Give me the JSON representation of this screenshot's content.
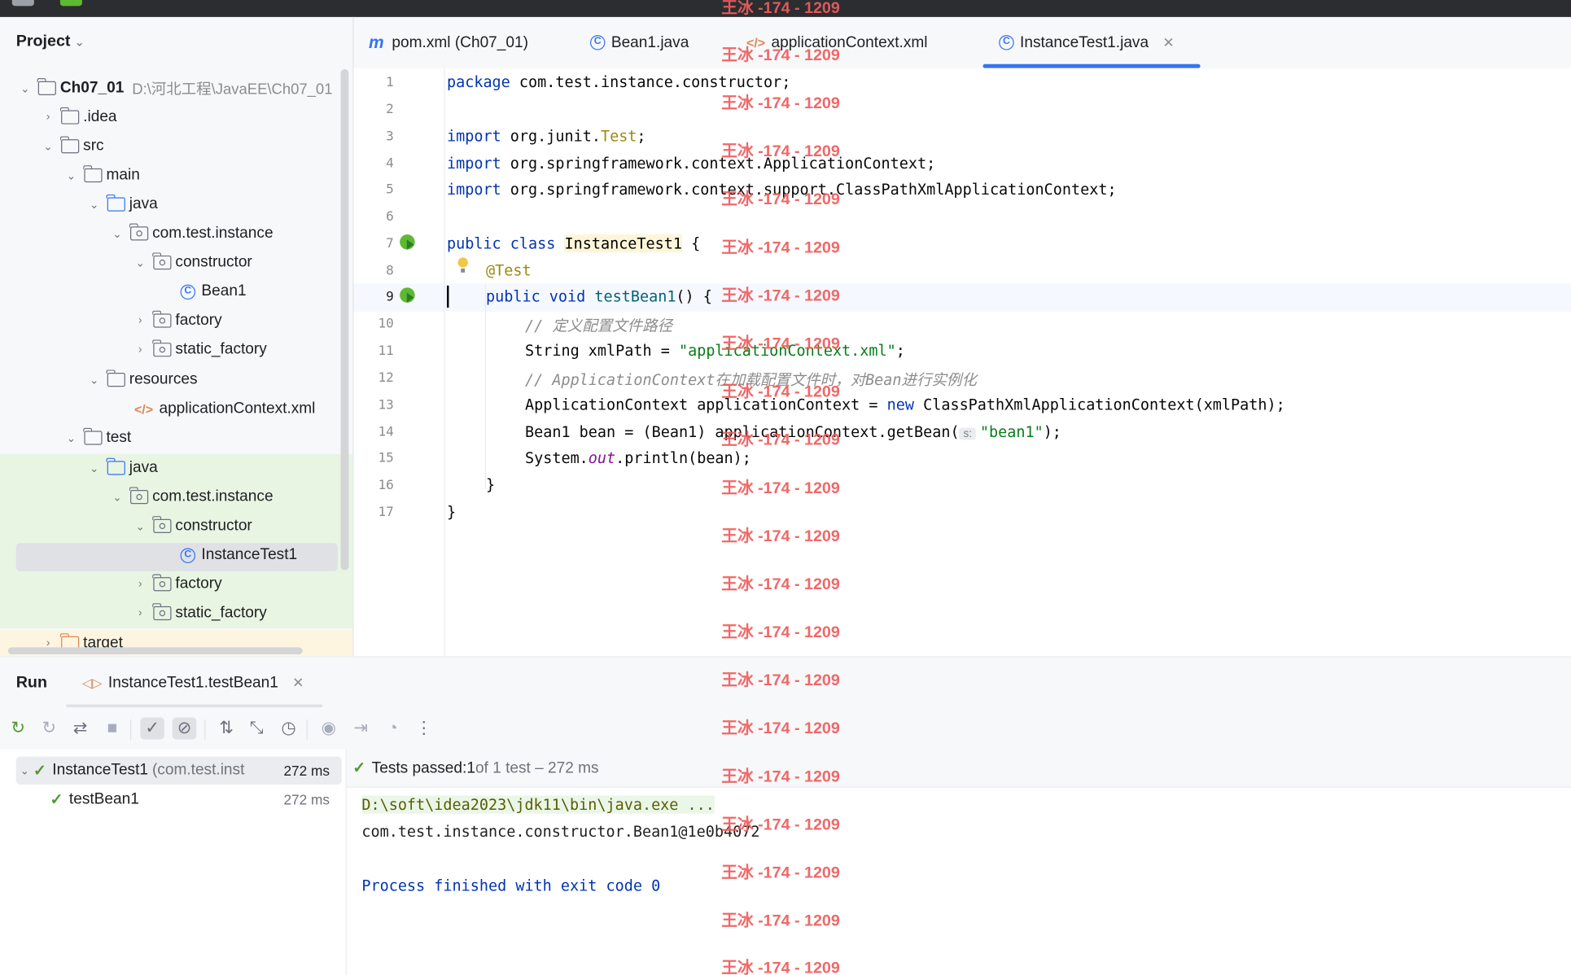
{
  "project": {
    "header": "Project",
    "root_name": "Ch07_01",
    "root_path": "D:\\河北工程\\JavaEE\\Ch07_01",
    "tree": [
      {
        "label": "Ch07_01"
      },
      {
        "label": ".idea"
      },
      {
        "label": "src"
      },
      {
        "label": "main"
      },
      {
        "label": "java"
      },
      {
        "label": "com.test.instance"
      },
      {
        "label": "constructor"
      },
      {
        "label": "Bean1"
      },
      {
        "label": "factory"
      },
      {
        "label": "static_factory"
      },
      {
        "label": "resources"
      },
      {
        "label": "applicationContext.xml"
      },
      {
        "label": "test"
      },
      {
        "label": "java"
      },
      {
        "label": "com.test.instance"
      },
      {
        "label": "constructor"
      },
      {
        "label": "InstanceTest1"
      },
      {
        "label": "factory"
      },
      {
        "label": "static_factory"
      },
      {
        "label": "target"
      }
    ]
  },
  "tabs": [
    {
      "label": "pom.xml (Ch07_01)"
    },
    {
      "label": "Bean1.java"
    },
    {
      "label": "applicationContext.xml"
    },
    {
      "label": "InstanceTest1.java"
    }
  ],
  "editor": {
    "line_numbers": [
      "1",
      "2",
      "3",
      "4",
      "5",
      "6",
      "7",
      "8",
      "9",
      "10",
      "11",
      "12",
      "13",
      "14",
      "15",
      "16",
      "17"
    ],
    "code": {
      "l1_kw": "package",
      "l1_rest": " com.test.instance.constructor;",
      "l3_kw": "import",
      "l3_a": " org.junit.",
      "l3_b": "Test",
      "l3_c": ";",
      "l4_kw": "import",
      "l4_rest": " org.springframework.context.ApplicationContext;",
      "l5_kw": "import",
      "l5_rest": " org.springframework.context.support.ClassPathXmlApplicationContext;",
      "l7_kw": "public class ",
      "l7_cls": "InstanceTest1",
      "l7_rest": " {",
      "l8_ann": "@Test",
      "l9_kw": "public void ",
      "l9_m": "testBean1",
      "l9_rest": "() {",
      "l10_cm": "// 定义配置文件路径",
      "l11_a": "String xmlPath = ",
      "l11_s": "\"applicationContext.xml\"",
      "l11_b": ";",
      "l12_cm": "// ApplicationContext在加载配置文件时，对Bean进行实例化",
      "l13_a": "ApplicationContext applicationContext = ",
      "l13_kw": "new",
      "l13_b": " ClassPathXmlApplicationContext(xmlPath);",
      "l14_a": "Bean1 bean = (Bean1) applicationContext.getBean(",
      "l14_hint": "s:",
      "l14_s": "\"bean1\"",
      "l14_b": ");",
      "l15_a": "System.",
      "l15_f": "out",
      "l15_b": ".println(bean);",
      "l16": "}",
      "l17": "}"
    }
  },
  "run": {
    "title": "Run",
    "tab_label": "InstanceTest1.testBean1",
    "tree": [
      {
        "label": "InstanceTest1",
        "pkg": "(com.test.inst",
        "time": "272 ms"
      },
      {
        "label": "testBean1",
        "time": "272 ms"
      }
    ],
    "tests_passed_a": "Tests passed: ",
    "tests_passed_n": "1",
    "tests_passed_b": " of 1 test – 272 ms",
    "console": [
      "D:\\soft\\idea2023\\jdk11\\bin\\java.exe ...",
      "com.test.instance.constructor.Bean1@1e0b4072",
      "",
      "Process finished with exit code 0"
    ]
  },
  "watermark": "王冰 -174 - 1209",
  "colors": {
    "accent": "#3574f0",
    "success": "#4e9a2f",
    "watermark": "#ef5c5c"
  }
}
